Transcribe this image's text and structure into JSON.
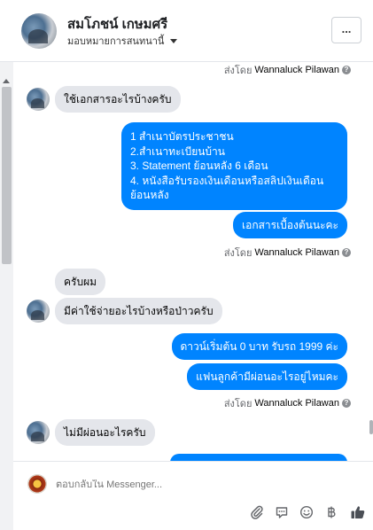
{
  "header": {
    "name": "สมโภชน์ เกษมศรี",
    "assignment": "มอบหมายการสนทนานี้",
    "more_icon": "..."
  },
  "sent_by_prefix": "ส่งโดย",
  "sent_by_agent": "Wannaluck Pilawan",
  "messages": {
    "in1": "ใช้เอกสารอะไรบ้างครับ",
    "out_list": [
      "1 สำเนาบัตรประชาชน",
      "2.สำเนาทะเบียนบ้าน",
      " 3. Statement ย้อนหลัง 6 เดือน",
      "4. หนังสือรับรองเงินเดือนหรือสลิปเงินเดือนย้อนหลัง"
    ],
    "out2": "เอกสารเบื้องต้นนะคะ",
    "in2": "ครับผม",
    "in3": "มีค่าใช้จ่ายอะไรบ้างหรือป่าวครับ",
    "out3": "ดาวน์เริ่มต้น 0 บาท รับรถ 1999 ค่ะ",
    "out4": "แฟนลูกค้ามีผ่อนอะไรอยู่ไหมคะ",
    "in4": "ไม่มีผ่อนอะไรครับ"
  },
  "composer": {
    "placeholder": "ตอบกลับใน Messenger...",
    "icons": [
      "attach-icon",
      "sticker-icon",
      "emoji-icon",
      "baht-icon",
      "like-icon"
    ]
  },
  "colors": {
    "accent": "#0084ff",
    "incoming": "#e4e6eb"
  }
}
